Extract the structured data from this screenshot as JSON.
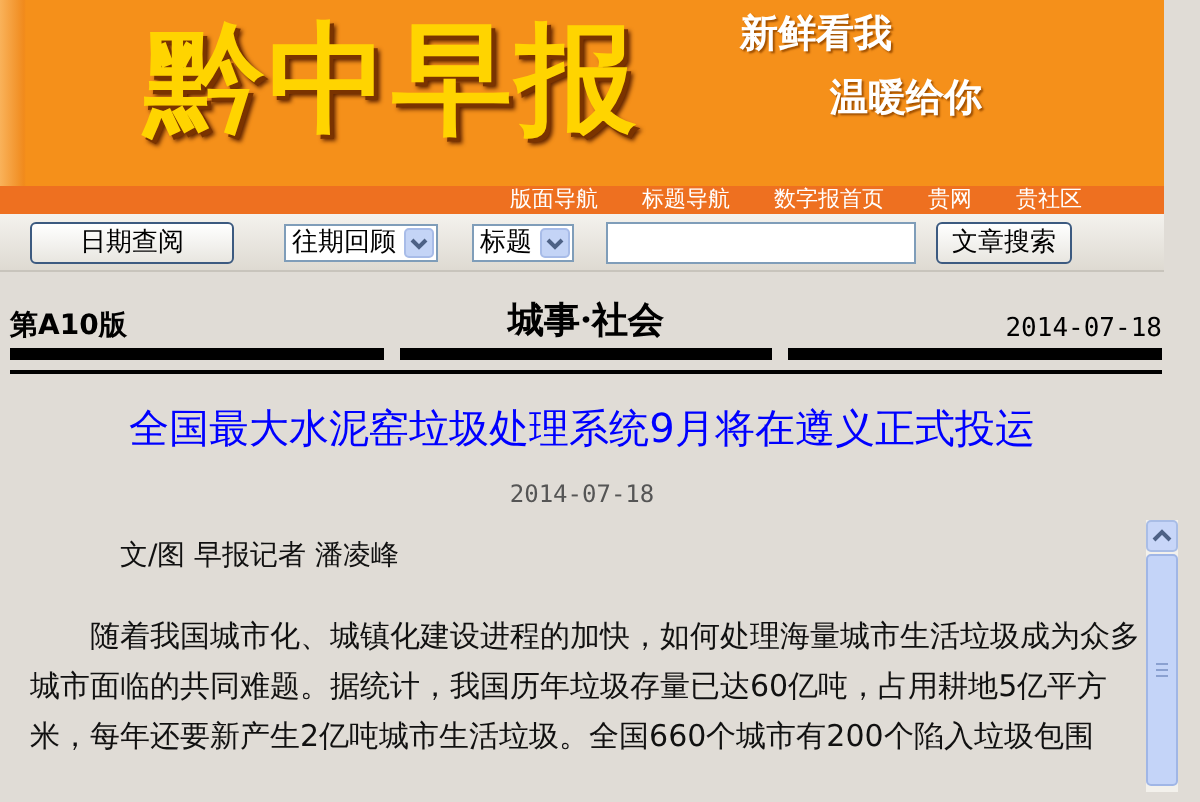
{
  "masthead": {
    "logo": "黔中早报",
    "slogans": [
      "新鲜看我",
      "温暖给你"
    ]
  },
  "nav": [
    "版面导航",
    "标题导航",
    "数字报首页",
    "贵网",
    "贵社区"
  ],
  "toolbar": {
    "date_button": "日期查阅",
    "archive_select": "往期回顾",
    "field_select": "标题",
    "search_button": "文章搜索"
  },
  "section": {
    "page": "第A10版",
    "name": "城事·社会",
    "date": "2014-07-18"
  },
  "article": {
    "title": "全国最大水泥窑垃圾处理系统9月将在遵义正式投运",
    "date": "2014-07-18",
    "byline": "文/图  早报记者  潘凌峰",
    "paragraphs": [
      "随着我国城市化、城镇化建设进程的加快，如何处理海量城市生活垃圾成为众多城市面临的共同难题。据统计，我国历年垃圾存量已达60亿吨，占用耕地5亿平方米，每年还要新产生2亿吨城市生活垃圾。全国660个城市有200个陷入垃圾包围"
    ]
  }
}
